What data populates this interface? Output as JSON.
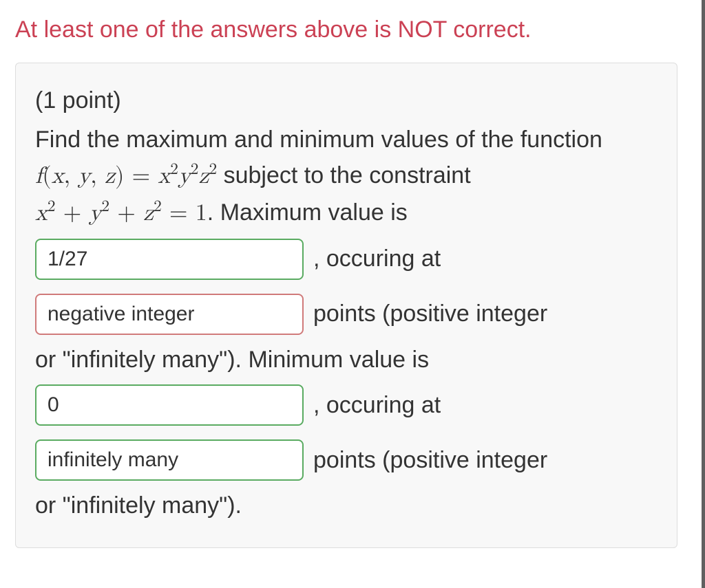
{
  "error_banner": "At least one of the answers above is NOT correct.",
  "points_label": "(1 point)",
  "prompt_line1": "Find the maximum and minimum values of the function",
  "func_lhs_parts": {
    "f": "f",
    "open": "(",
    "x": "x",
    "c1": ", ",
    "y": "y",
    "c2": ", ",
    "z": "z",
    "close": ") = "
  },
  "func_rhs_parts": {
    "x": "x",
    "e1": "2",
    "y": "y",
    "e2": "2",
    "z": "z",
    "e3": "2"
  },
  "subject_to": " subject to the constraint",
  "constraint": {
    "x": "x",
    "ex": "2",
    "p1": " + ",
    "y": "y",
    "ey": "2",
    "p2": " + ",
    "z": "z",
    "ez": "2",
    "eq": " = 1"
  },
  "max_label": ". Maximum value is",
  "answers": {
    "max_value": "1/27",
    "max_points": "negative integer",
    "min_value": "0",
    "min_points": "infinitely many"
  },
  "occuring_at": ", occuring at",
  "points_hint_tail": "points (positive integer",
  "or_inf_many_mid": "or \"infinitely many\"). Minimum value is",
  "or_inf_many_end": "or \"infinitely many\")."
}
